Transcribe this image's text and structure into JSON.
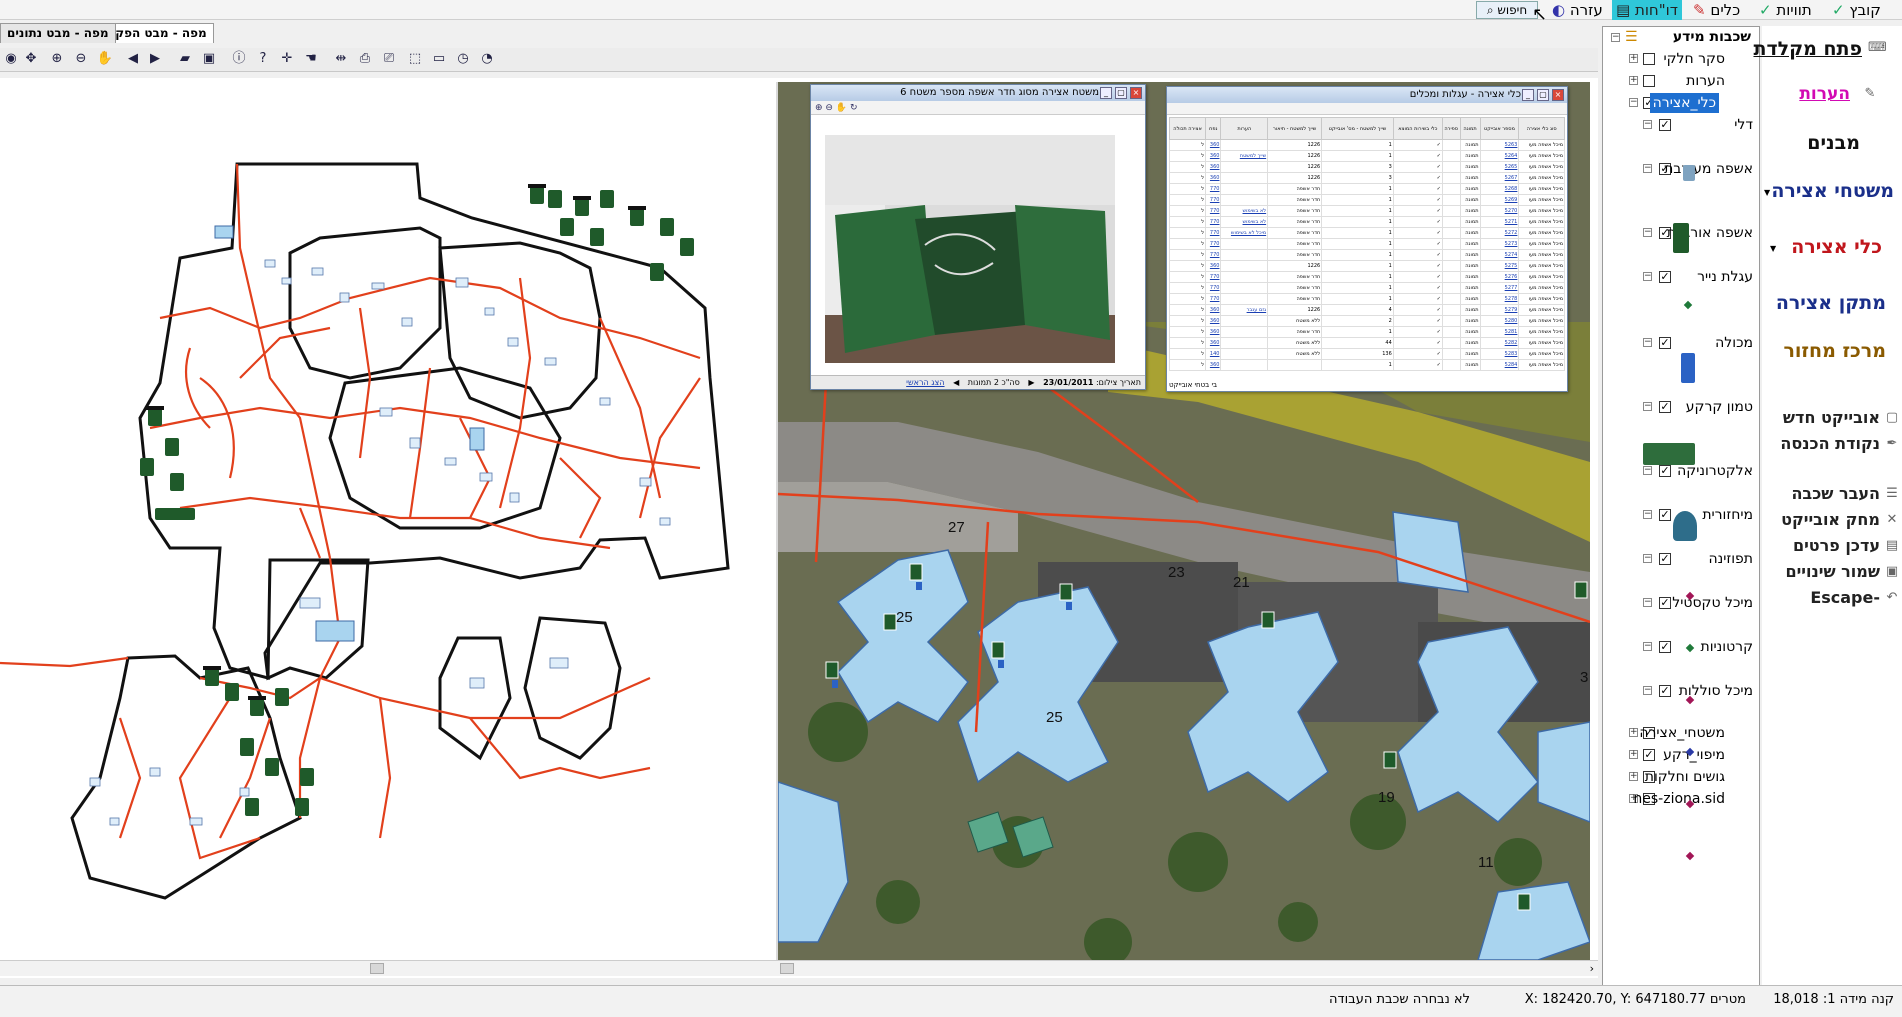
{
  "menubar": {
    "items": [
      "קובץ",
      "תוויות",
      "כלים",
      "דו\"חות",
      "עזרה"
    ],
    "search_label": "חיפוש"
  },
  "tabs": [
    "מפה - מבט הפקה",
    "מפה - מבט נתונים"
  ],
  "toolbar": {
    "icons": [
      "pan-icon",
      "zoom-all-icon",
      "zoom-in-icon",
      "zoom-out-icon",
      "hand-icon",
      "back-icon",
      "forward-icon",
      "open-folder-icon",
      "save-icon",
      "info-icon",
      "help-icon",
      "move-icon",
      "grab-icon",
      "measure-icon",
      "print-icon",
      "print-setup-icon",
      "select-icon",
      "select-area-icon",
      "clock-icon",
      "compass-icon"
    ]
  },
  "photo_window": {
    "title": "משטח אצירה מסוג חדר אשפה מספר משטח 6",
    "footer_date": "23/01/2011",
    "footer_date_label": "תאריך צילום:",
    "footer_count": "סה\"כ 2 תמונות",
    "footer_link": "הצג הראשי"
  },
  "table_window": {
    "title": "כלי אצירה - עגלות ומכלים",
    "headers": [
      "סוג כלי אצירה",
      "מספר אובייקט",
      "תמונה",
      "ספירה",
      "כלי בשירות המוצא",
      "שייך למשטח - מס' אובייקט",
      "שייך למשטח - תיאור",
      "הערות",
      "נפח",
      "אצירה תכולה"
    ],
    "footer": "בי בטחי אובייקט",
    "rows": [
      [
        "מיכל אשפה מעו",
        "5263",
        "תמונה",
        "",
        "✓",
        "1",
        "1226",
        "",
        "360",
        "ל"
      ],
      [
        "מיכל אשפה מעו",
        "5264",
        "תמונה",
        "",
        "✓",
        "1",
        "1226",
        "שייך למשטח",
        "360",
        "ל"
      ],
      [
        "מיכל אשפה מעו",
        "5265",
        "תמונה",
        "",
        "✓",
        "3",
        "1226",
        "",
        "360",
        "ל"
      ],
      [
        "מיכל אשפה מעו",
        "5267",
        "תמונה",
        "",
        "✓",
        "3",
        "1226",
        "",
        "360",
        "ל"
      ],
      [
        "מיכל אשפה מעו",
        "5268",
        "תמונה",
        "",
        "✓",
        "1",
        "חדר אשפה",
        "",
        "770",
        "ל"
      ],
      [
        "מיכל אשפה מעו",
        "5269",
        "תמונה",
        "",
        "✓",
        "1",
        "חדר אשפה",
        "",
        "770",
        "ל"
      ],
      [
        "מיכל אשפה מעו",
        "5270",
        "תמונה",
        "",
        "✓",
        "1",
        "חדר אשפה",
        "לא בשימוש",
        "770",
        "ל"
      ],
      [
        "מיכל אשפה מעו",
        "5271",
        "תמונה",
        "",
        "✓",
        "1",
        "חדר אשפה",
        "לא בשימוש",
        "770",
        "ל"
      ],
      [
        "מיכל אשפה מעו",
        "5272",
        "תמונה",
        "",
        "✓",
        "1",
        "חדר אשפה",
        "מיכל לא בשימוש",
        "770",
        "ל"
      ],
      [
        "מיכל אשפה מעו",
        "5273",
        "תמונה",
        "",
        "✓",
        "1",
        "חדר אשפה",
        "",
        "770",
        "ל"
      ],
      [
        "מיכל אשפה מעו",
        "5274",
        "תמונה",
        "",
        "✓",
        "1",
        "חדר אשפה",
        "",
        "770",
        "ל"
      ],
      [
        "מיכל אשפה מעו",
        "5275",
        "תמונה",
        "",
        "✓",
        "1",
        "1226",
        "",
        "360",
        "ל"
      ],
      [
        "מיכל אשפה מעו",
        "5276",
        "תמונה",
        "",
        "✓",
        "1",
        "חדר אשפה",
        "",
        "770",
        "ל"
      ],
      [
        "מיכל אשפה מעו",
        "5277",
        "תמונה",
        "",
        "✓",
        "1",
        "חדר אשפה",
        "",
        "770",
        "ל"
      ],
      [
        "מיכל אשפה מעו",
        "5278",
        "תמונה",
        "",
        "✓",
        "1",
        "חדר אשפה",
        "",
        "770",
        "ל"
      ],
      [
        "מיכל אשפה מעו",
        "5279",
        "תמונה",
        "",
        "✓",
        "4",
        "1226",
        "גזם ענבר",
        "360",
        "ל"
      ],
      [
        "מיכל אשפה מעו",
        "5280",
        "תמונה",
        "",
        "✓",
        "2",
        "ללא משטח",
        "",
        "360",
        "ל"
      ],
      [
        "מיכל אשפה מעו",
        "5281",
        "תמונה",
        "",
        "✓",
        "1",
        "חדר אשפה",
        "",
        "360",
        "ל"
      ],
      [
        "מיכל אשפה מעו",
        "5282",
        "תמונה",
        "",
        "✓",
        "44",
        "ללא משטח",
        "",
        "360",
        "ל"
      ],
      [
        "מיכל אשפה מעו",
        "5283",
        "תמונה",
        "",
        "✓",
        "136",
        "ללא משטח",
        "",
        "140",
        "ל"
      ],
      [
        "מיכל אשפה מעו",
        "5284",
        "תמונה",
        "",
        "✓",
        "1",
        "",
        "",
        "360",
        "ל"
      ]
    ]
  },
  "map_labels": [
    "27",
    "23",
    "21",
    "25",
    "25",
    "19",
    "11",
    "3"
  ],
  "layer_tree": {
    "root": "שכבות מידע",
    "items": [
      {
        "label": "סקר חלקי",
        "checked": false,
        "expander": "+",
        "level": 0
      },
      {
        "label": "הערות",
        "checked": false,
        "expander": "+",
        "level": 0
      },
      {
        "label": "כלי_אצירה",
        "checked": true,
        "expander": "−",
        "level": 0,
        "selected": true
      },
      {
        "label": "דלי",
        "checked": true,
        "expander": "−",
        "level": 1
      },
      {
        "label": "אשפה מעורבת",
        "checked": true,
        "expander": "−",
        "level": 1
      },
      {
        "label": "אשפה אורגנית",
        "checked": true,
        "expander": "−",
        "level": 1
      },
      {
        "label": "עגלת נייר",
        "checked": true,
        "expander": "−",
        "level": 1
      },
      {
        "label": "מכולה",
        "checked": true,
        "expander": "−",
        "level": 1
      },
      {
        "label": "טמון קרקע",
        "checked": true,
        "expander": "−",
        "level": 1
      },
      {
        "label": "אלקטרוניקה",
        "checked": true,
        "expander": "−",
        "level": 1
      },
      {
        "label": "מיחזורית",
        "checked": true,
        "expander": "−",
        "level": 1
      },
      {
        "label": "תפוזינה",
        "checked": true,
        "expander": "−",
        "level": 1
      },
      {
        "label": "מיכל טקסטיל",
        "checked": true,
        "expander": "−",
        "level": 1
      },
      {
        "label": "קרטוניות",
        "checked": true,
        "expander": "−",
        "level": 1
      },
      {
        "label": "מיכל סוללות",
        "checked": true,
        "expander": "−",
        "level": 1
      },
      {
        "label": "משטחי_אצירה",
        "checked": true,
        "expander": "+",
        "level": 0
      },
      {
        "label": "מיפוי_רקע",
        "checked": true,
        "expander": "+",
        "level": 0
      },
      {
        "label": "גושים וחלקות",
        "checked": false,
        "expander": "+",
        "level": 0
      },
      {
        "label": "nes-ziona.sid",
        "checked": false,
        "expander": "+",
        "level": 0
      }
    ]
  },
  "commands": {
    "keyboard": "פתח מקלדת",
    "notes": "הערות",
    "buildings": "מבנים",
    "surfaces": "משטחי אצירה",
    "containers": "כלי אצירה",
    "facility": "מתקן אצירה",
    "recycle": "מרכז מחזור",
    "new_object": "אובייקט חדש",
    "entry_point": "נקודת הכנסה",
    "move_layer": "העבר שכבה",
    "delete_object": "מחק אובייקט",
    "update_details": "עדכן פרטים",
    "save_changes": "שמור שינויים",
    "escape": "Escape-"
  },
  "colors": {
    "accent": "#2fc7d9",
    "road": "#e2401c",
    "selection": "#1e6fd0",
    "command_blue": "#1a2f8a",
    "command_red": "#c0161c",
    "command_pink": "#d20ab3",
    "command_brown": "#8a5a00",
    "bin_green": "#1f5a2a",
    "roof_blue": "#a9d4ef"
  },
  "status": {
    "scale": "קנה מידה 1: 18,018",
    "coords": "X: 182420.70, Y: 647180.77 מטרים",
    "work_layer": "לא נבחרה שכבת העבודה"
  }
}
